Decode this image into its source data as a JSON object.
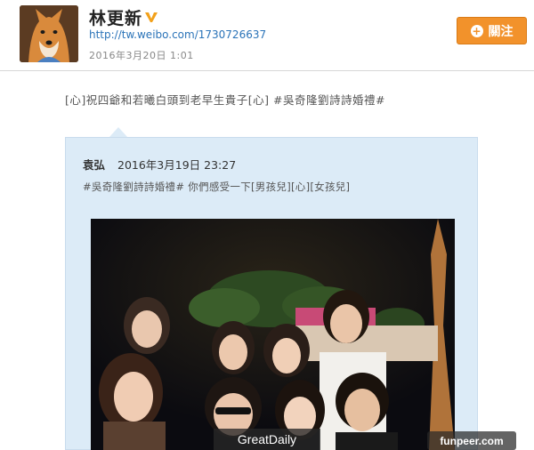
{
  "profile": {
    "name": "林更新",
    "link": "http://tw.weibo.com/1730726637",
    "timestamp": "2016年3月20日 1:01",
    "follow_label": "關注",
    "avatar_icon": "shiba-dog-avatar",
    "verified_icon": "verified-v-icon"
  },
  "post": {
    "text": "[心]祝四爺和若曦白頭到老早生貴子[心] #吳奇隆劉詩詩婚禮#"
  },
  "repost": {
    "author": "袁弘",
    "date": "2016年3月19日 23:27",
    "text": "#吳奇隆劉詩詩婚禮# 你們感受一下[男孩兒][心][女孩兒]"
  },
  "watermarks": {
    "left": "GreatDaily",
    "right": "funpeer.com"
  },
  "colors": {
    "follow_button": "#f2922b",
    "link": "#2a73b8",
    "repost_bg": "#dcebf7"
  }
}
